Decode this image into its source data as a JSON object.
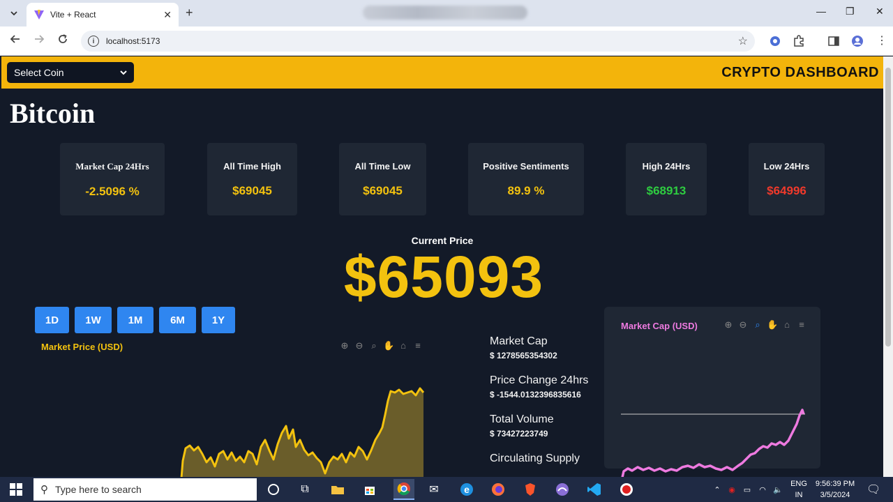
{
  "browser": {
    "tab_title": "Vite + React",
    "url": "localhost:5173"
  },
  "header": {
    "select_label": "Select Coin",
    "title": "CRYPTO DASHBOARD"
  },
  "coin": {
    "name": "Bitcoin"
  },
  "cards": [
    {
      "label": "Market Cap 24Hrs",
      "value": "-2.5096 %",
      "color": "#f3c20f"
    },
    {
      "label": "All Time High",
      "value": "$69045",
      "color": "#f3c20f"
    },
    {
      "label": "All Time Low",
      "value": "$69045",
      "color": "#f3c20f"
    },
    {
      "label": "Positive Sentiments",
      "value": "89.9 %",
      "color": "#f3c20f"
    },
    {
      "label": "High 24Hrs",
      "value": "$68913",
      "color": "#2ecc40"
    },
    {
      "label": "Low 24Hrs",
      "value": "$64996",
      "color": "#f0392b"
    }
  ],
  "current_price": {
    "label": "Current Price",
    "value": "$65093"
  },
  "ranges": [
    "1D",
    "1W",
    "1M",
    "6M",
    "1Y"
  ],
  "market_price_chart": {
    "title": "Market Price (USD)"
  },
  "stats": [
    {
      "label": "Market Cap",
      "value": "$ 1278565354302"
    },
    {
      "label": "Price Change 24hrs",
      "value": "$ -1544.0132396835616"
    },
    {
      "label": "Total Volume",
      "value": "$ 73427223749"
    },
    {
      "label": "Circulating Supply",
      "value": ""
    }
  ],
  "market_cap_chart": {
    "title": "Market Cap (USD)"
  },
  "taskbar": {
    "search_placeholder": "Type here to search",
    "lang_top": "ENG",
    "lang_bottom": "IN",
    "time": "9:56:39 PM",
    "date": "3/5/2024"
  },
  "colors": {
    "accent": "#f3b40b",
    "price": "#f3c20f",
    "button": "#2f86f0",
    "mc_line": "#ee7ae0"
  }
}
